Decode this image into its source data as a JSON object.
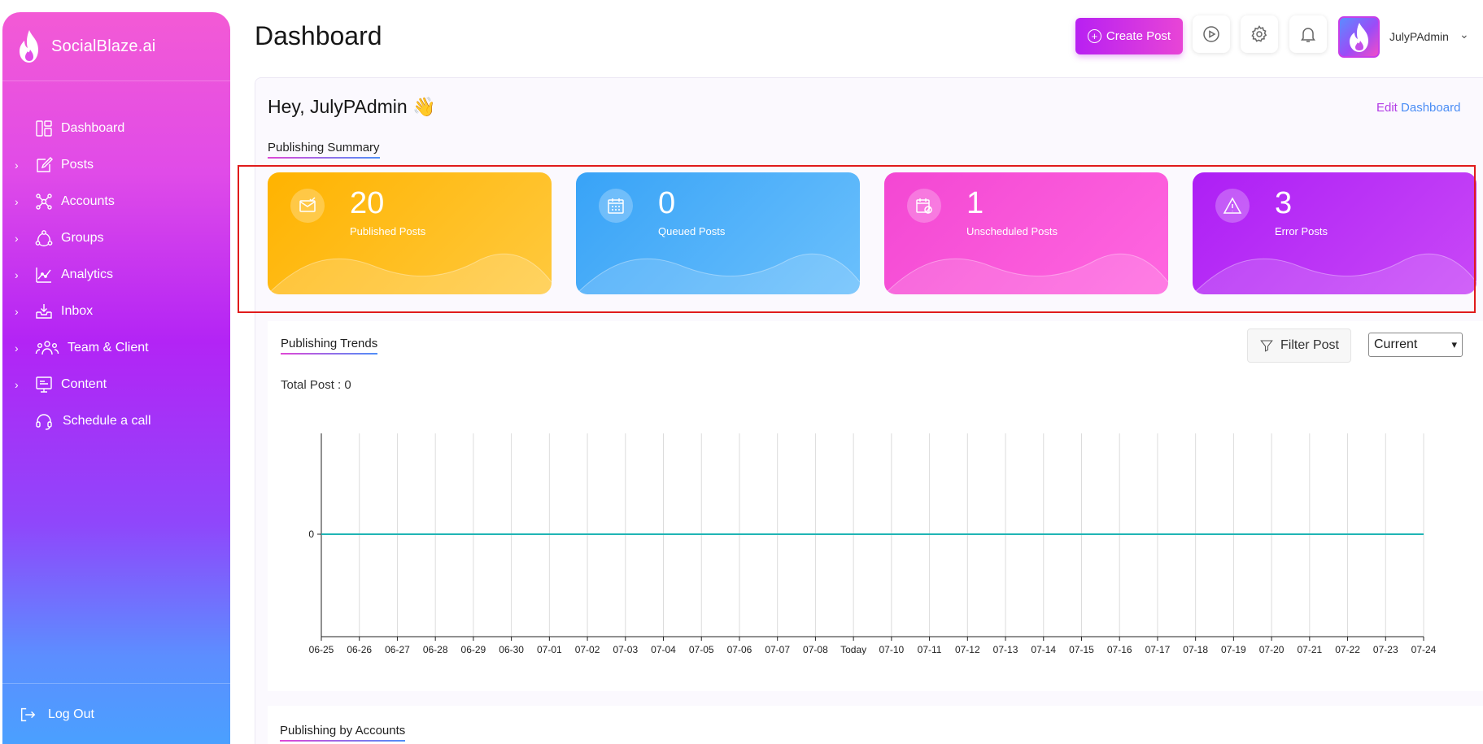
{
  "brand": {
    "name": "SocialBlaze.ai"
  },
  "sidebar": {
    "items": [
      {
        "label": "Dashboard",
        "icon": "dashboard-icon",
        "expandable": false
      },
      {
        "label": "Posts",
        "icon": "edit-icon",
        "expandable": true
      },
      {
        "label": "Accounts",
        "icon": "network-icon",
        "expandable": true
      },
      {
        "label": "Groups",
        "icon": "groups-icon",
        "expandable": true
      },
      {
        "label": "Analytics",
        "icon": "analytics-icon",
        "expandable": true
      },
      {
        "label": "Inbox",
        "icon": "inbox-icon",
        "expandable": true
      },
      {
        "label": "Team & Client",
        "icon": "team-icon",
        "expandable": true
      },
      {
        "label": "Content",
        "icon": "content-icon",
        "expandable": true
      },
      {
        "label": "Schedule a call",
        "icon": "headset-icon",
        "expandable": false
      }
    ],
    "logout": "Log Out"
  },
  "header": {
    "title": "Dashboard",
    "create_post": "Create Post",
    "user": "JulyPAdmin"
  },
  "main": {
    "greeting": "Hey, JulyPAdmin 👋",
    "edit_prefix": "Edit",
    "edit_suffix": "Dashboard",
    "publishing_summary": "Publishing Summary",
    "cards": [
      {
        "value": "20",
        "label": "Published Posts",
        "color": "#ffb400"
      },
      {
        "value": "0",
        "label": "Queued Posts",
        "color": "#3aa5f8"
      },
      {
        "value": "1",
        "label": "Unscheduled Posts",
        "color": "#f44fd6"
      },
      {
        "value": "3",
        "label": "Error Posts",
        "color": "#b321f5"
      }
    ],
    "publishing_trends": "Publishing Trends",
    "filter_post": "Filter Post",
    "range": "Current",
    "total_post": "Total Post : 0",
    "publishing_by_accounts": "Publishing by Accounts"
  },
  "chart_data": {
    "type": "line",
    "categories": [
      "06-25",
      "06-26",
      "06-27",
      "06-28",
      "06-29",
      "06-30",
      "07-01",
      "07-02",
      "07-03",
      "07-04",
      "07-05",
      "07-06",
      "07-07",
      "07-08",
      "Today",
      "07-10",
      "07-11",
      "07-12",
      "07-13",
      "07-14",
      "07-15",
      "07-16",
      "07-17",
      "07-18",
      "07-19",
      "07-20",
      "07-21",
      "07-22",
      "07-23",
      "07-24"
    ],
    "series": [
      {
        "values": [
          0,
          0,
          0,
          0,
          0,
          0,
          0,
          0,
          0,
          0,
          0,
          0,
          0,
          0,
          0,
          0,
          0,
          0,
          0,
          0,
          0,
          0,
          0,
          0,
          0,
          0,
          0,
          0,
          0,
          0
        ],
        "color": "#1fb5b5"
      }
    ],
    "yticks": [
      "0"
    ],
    "grid": true
  }
}
